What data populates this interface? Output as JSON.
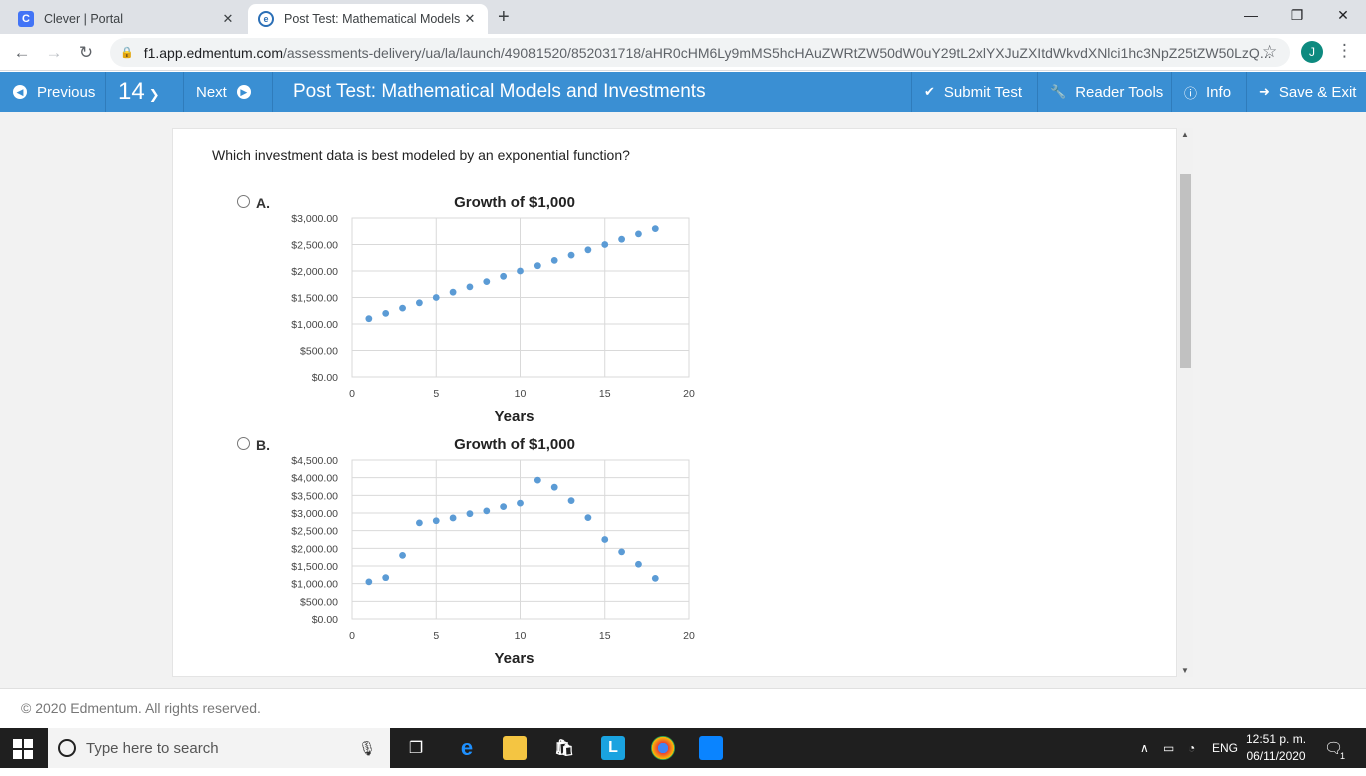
{
  "browser": {
    "tabs": [
      {
        "title": "Clever | Portal",
        "favicon": "C"
      },
      {
        "title": "Post Test: Mathematical Models a",
        "favicon": "e"
      }
    ],
    "url_host": "f1.app.edmentum.com",
    "url_path": "/assessments-delivery/ua/la/launch/49081520/852031718/aHR0cHM6Ly9mMS5hcHAuZWRtZW50dW0uY29tL2xlYXJuZXItdWkvdXNlci1hc3NpZ25tZW50LzQ...",
    "profile_initial": "J"
  },
  "header": {
    "previous_label": "Previous",
    "question_number": "14",
    "next_label": "Next",
    "title": "Post Test: Mathematical Models and Investments",
    "submit_label": "Submit Test",
    "reader_tools_label": "Reader Tools",
    "info_label": "Info",
    "save_exit_label": "Save & Exit",
    "accent_color": "#3a8fd3"
  },
  "question": {
    "prompt": "Which investment data is best modeled by an exponential function?",
    "options": [
      {
        "label": "A."
      },
      {
        "label": "B."
      }
    ]
  },
  "chart_data": [
    {
      "type": "scatter",
      "title": "Growth of $1,000",
      "xlabel": "Years",
      "ylabel": "",
      "xlim": [
        0,
        20
      ],
      "ylim": [
        0,
        3000
      ],
      "xticks": [
        "0",
        "5",
        "10",
        "15",
        "20"
      ],
      "yticks": [
        "$0.00",
        "$500.00",
        "$1,000.00",
        "$1,500.00",
        "$2,000.00",
        "$2,500.00",
        "$3,000.00"
      ],
      "grid": true,
      "color": "#5b9bd5",
      "x": [
        1,
        2,
        3,
        4,
        5,
        6,
        7,
        8,
        9,
        10,
        11,
        12,
        13,
        14,
        15,
        16,
        17,
        18
      ],
      "y": [
        1100,
        1200,
        1300,
        1400,
        1500,
        1600,
        1700,
        1800,
        1900,
        2000,
        2100,
        2200,
        2300,
        2400,
        2500,
        2600,
        2700,
        2800
      ]
    },
    {
      "type": "scatter",
      "title": "Growth of $1,000",
      "xlabel": "Years",
      "ylabel": "",
      "xlim": [
        0,
        20
      ],
      "ylim": [
        0,
        4500
      ],
      "xticks": [
        "0",
        "5",
        "10",
        "15",
        "20"
      ],
      "yticks": [
        "$0.00",
        "$500.00",
        "$1,000.00",
        "$1,500.00",
        "$2,000.00",
        "$2,500.00",
        "$3,000.00",
        "$3,500.00",
        "$4,000.00",
        "$4,500.00"
      ],
      "grid": true,
      "color": "#5b9bd5",
      "x": [
        1,
        2,
        3,
        4,
        5,
        6,
        7,
        8,
        9,
        10,
        11,
        12,
        13,
        14,
        15,
        16,
        17,
        18
      ],
      "y": [
        1050,
        1170,
        1800,
        2720,
        2780,
        2860,
        2980,
        3060,
        3180,
        3280,
        3930,
        3730,
        3350,
        2870,
        2250,
        1900,
        1550,
        1150
      ]
    }
  ],
  "footer": {
    "copyright": "© 2020 Edmentum. All rights reserved."
  },
  "taskbar": {
    "search_placeholder": "Type here to search",
    "language": "ENG",
    "time": "12:51 p. m.",
    "date": "06/11/2020",
    "notification_count": "1"
  }
}
